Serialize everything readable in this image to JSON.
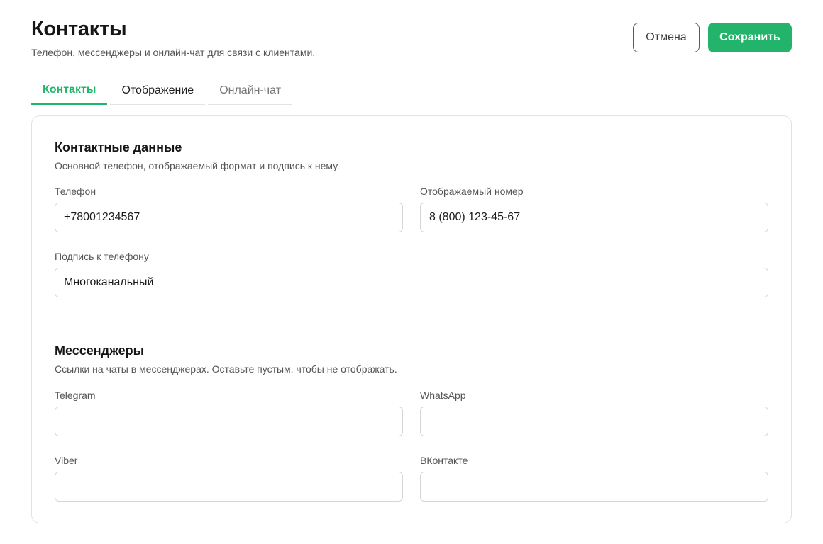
{
  "header": {
    "title": "Контакты",
    "subtitle": "Телефон, мессенджеры и онлайн-чат для связи с клиентами."
  },
  "actions": {
    "cancel_label": "Отмена",
    "save_label": "Сохранить"
  },
  "colors": {
    "accent": "#22b46a"
  },
  "tabs": [
    {
      "label": "Контакты",
      "active": true
    },
    {
      "label": "Отображение",
      "active": false
    },
    {
      "label": "Онлайн-чат",
      "active": false
    }
  ],
  "contact_section": {
    "title": "Контактные данные",
    "description": "Основной телефон, отображаемый формат и подпись к нему.",
    "phone": {
      "label": "Телефон",
      "value": "+78001234567"
    },
    "display_number": {
      "label": "Отображаемый номер",
      "value": "8 (800) 123-45-67"
    },
    "phone_caption": {
      "label": "Подпись к телефону",
      "value": "Многоканальный"
    }
  },
  "messengers_section": {
    "title": "Мессенджеры",
    "description": "Ссылки на чаты в мессенджерах. Оставьте пустым, чтобы не отображать.",
    "telegram": {
      "label": "Telegram",
      "value": ""
    },
    "whatsapp": {
      "label": "WhatsApp",
      "value": ""
    },
    "viber": {
      "label": "Viber",
      "value": ""
    },
    "vkontakte": {
      "label": "ВКонтакте",
      "value": ""
    }
  }
}
